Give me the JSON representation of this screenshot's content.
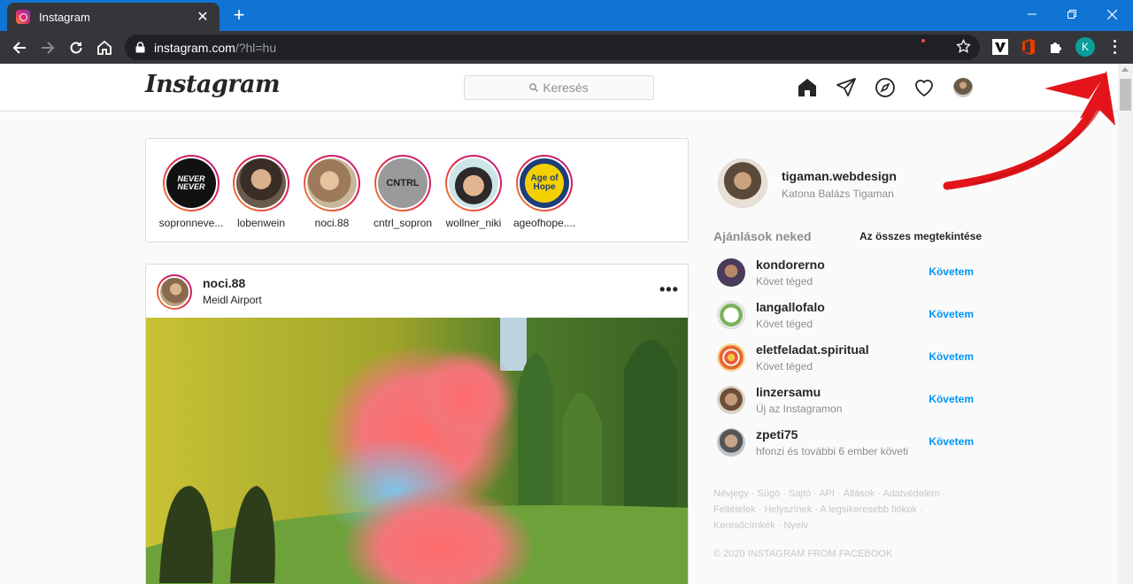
{
  "browser": {
    "tab_title": "Instagram",
    "url_host": "instagram.com",
    "url_path": "/?hl=hu",
    "profile_initial": "K"
  },
  "header": {
    "logo": "Instagram",
    "search_placeholder": "Keresés",
    "icons": [
      "home-icon",
      "direct-icon",
      "explore-icon",
      "heart-icon",
      "profile-avatar"
    ]
  },
  "stories": [
    {
      "name": "sopronneve...",
      "pic_text": "NEVER NEVER"
    },
    {
      "name": "lobenwein",
      "pic_text": ""
    },
    {
      "name": "noci.88",
      "pic_text": ""
    },
    {
      "name": "cntrl_sopron",
      "pic_text": "CNTRL"
    },
    {
      "name": "wollner_niki",
      "pic_text": ""
    },
    {
      "name": "ageofhope....",
      "pic_text": "Age of Hope"
    }
  ],
  "post": {
    "username": "noci.88",
    "location": "Meidl Airport",
    "more": "•••"
  },
  "sidebar": {
    "me_username": "tigaman.webdesign",
    "me_fullname": "Katona Balázs Tigaman",
    "suggestions_title": "Ajánlások neked",
    "see_all": "Az összes megtekintése",
    "follow_label": "Követem",
    "suggestions": [
      {
        "username": "kondorerno",
        "sub": "Követ téged"
      },
      {
        "username": "langallofalo",
        "sub": "Követ téged"
      },
      {
        "username": "eletfeladat.spiritual",
        "sub": "Követ téged"
      },
      {
        "username": "linzersamu",
        "sub": "Új az Instagramon"
      },
      {
        "username": "zpeti75",
        "sub": "hfonzi és további 6 ember követi"
      }
    ],
    "footer_line1": "Névjegy · Súgó · Sajtó · API · Állások · Adatvédelem ·",
    "footer_line2": "Feltételek · Helyszínek · A legsikeresebb fiókok ·",
    "footer_line3": "Keresőcímkék · Nyelv",
    "copyright": "© 2020 INSTAGRAM FROM FACEBOOK"
  },
  "colors": {
    "titlebar": "#0f74d4",
    "toolbar": "#35363a",
    "follow_blue": "#0095f6",
    "annotation_red": "#e3151a"
  }
}
